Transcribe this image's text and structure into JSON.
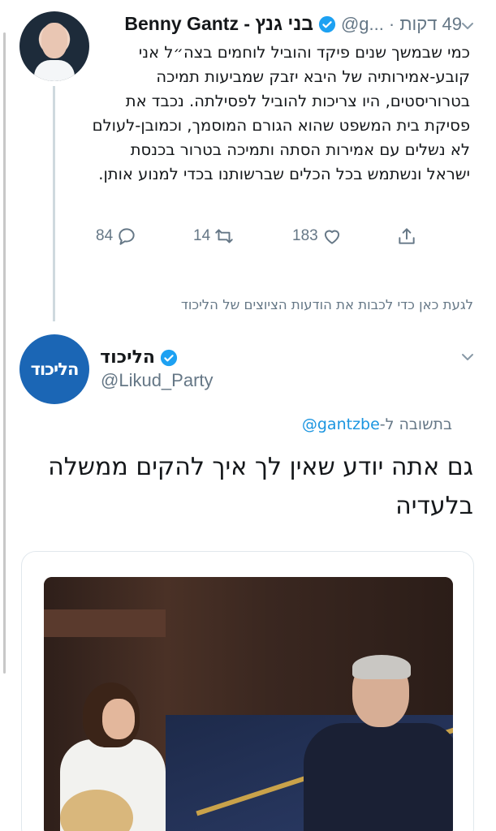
{
  "tweet1": {
    "name": "Benny Gantz - בני גנץ",
    "handle": "@g...",
    "time": "49 דקות ·",
    "body": "כמי שבמשך שנים פיקד והוביל לוחמים בצה״ל אני קובע-אמירותיה של היבא יזבק שמביעות תמיכה בטרוריסטים, היו צריכות להוביל לפסילתה. נכבד את פסיקת בית המשפט שהוא הגורם המוסמך, וכמובן-לעולם לא נשלים עם אמירות הסתה ותמיכה בטרור בכנסת ישראל ונשתמש בכל הכלים שברשותנו בכדי למנוע אותן.",
    "replies": "84",
    "retweets": "14",
    "likes": "183"
  },
  "show_thread": "לגעת כאן כדי לכבות את הודעות הציוצים של הליכוד",
  "tweet2": {
    "name": "הליכוד",
    "handle": "@Likud_Party",
    "avatar_text": "הליכוד",
    "reply_prefix": "בתשובה ל-",
    "reply_mention": "@gantzbe",
    "body": "גם אתה יודע שאין לך איך להקים ממשלה בלעדיה"
  },
  "colors": {
    "verified": "#1da1f2",
    "secondary_text": "#657786",
    "mention": "#1b95e0",
    "likud_blue": "#1b66b5"
  },
  "icons": [
    "reply-icon",
    "retweet-icon",
    "like-icon",
    "share-icon",
    "verified-icon",
    "chevron-down-icon"
  ]
}
